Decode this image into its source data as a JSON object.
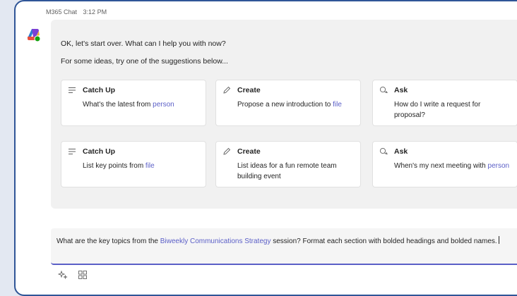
{
  "header": {
    "sender": "M365 Chat",
    "time": "3:12 PM"
  },
  "message": {
    "line1": "OK, let's start over. What can I help you with now?",
    "line2": "For some ideas, try one of the suggestions below..."
  },
  "cards": [
    {
      "icon": "lines-icon",
      "title": "Catch Up",
      "pre": "What's the latest from ",
      "link": "person",
      "post": ""
    },
    {
      "icon": "pencil-icon",
      "title": "Create",
      "pre": "Propose a new introduction to ",
      "link": "file",
      "post": ""
    },
    {
      "icon": "chat-bubbles-icon",
      "title": "Ask",
      "pre": "How do I write a request for proposal?",
      "link": "",
      "post": ""
    },
    {
      "icon": "lines-icon",
      "title": "Catch Up",
      "pre": "List key points from ",
      "link": "file",
      "post": ""
    },
    {
      "icon": "pencil-icon",
      "title": "Create",
      "pre": "List ideas for a fun remote team building event",
      "link": "",
      "post": ""
    },
    {
      "icon": "chat-bubbles-icon",
      "title": "Ask",
      "pre": "When's my next meeting with ",
      "link": "person",
      "post": ""
    }
  ],
  "composer": {
    "pre": "What are the key topics from the ",
    "link": "Biweekly Communications Strategy",
    "post": " session? Format each section with bolded headings and bolded names."
  },
  "toolbar": [
    "sparkle-icon",
    "apps-grid-icon"
  ],
  "colors": {
    "accent": "#5b5fc7",
    "frame": "#2f5597",
    "background": "#e3e8f2"
  }
}
